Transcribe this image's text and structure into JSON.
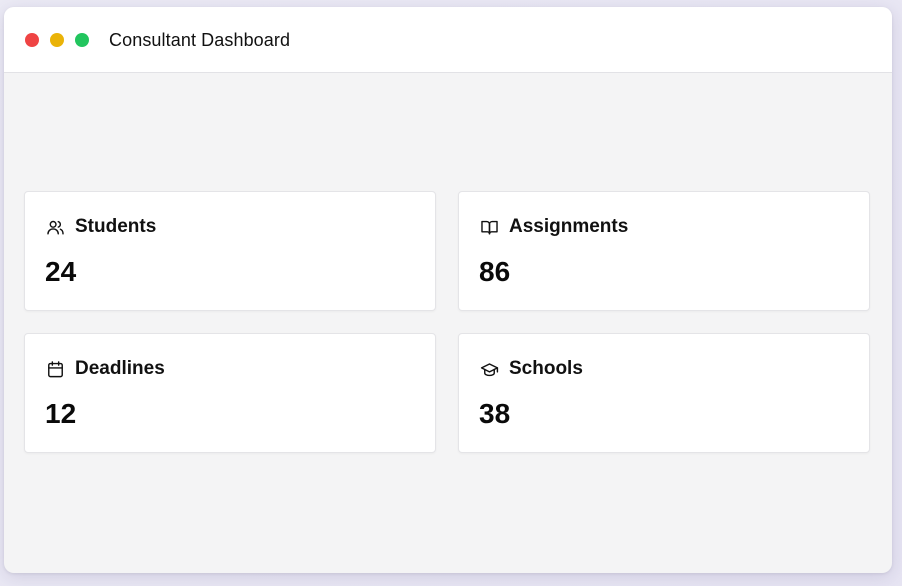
{
  "window": {
    "title": "Consultant Dashboard",
    "controls": {
      "close_color": "#ef4444",
      "minimize_color": "#eab308",
      "maximize_color": "#22c55e"
    }
  },
  "stats": [
    {
      "label": "Students",
      "value": "24",
      "icon": "users-icon"
    },
    {
      "label": "Assignments",
      "value": "86",
      "icon": "book-open-icon"
    },
    {
      "label": "Deadlines",
      "value": "12",
      "icon": "calendar-icon"
    },
    {
      "label": "Schools",
      "value": "38",
      "icon": "graduation-cap-icon"
    }
  ]
}
